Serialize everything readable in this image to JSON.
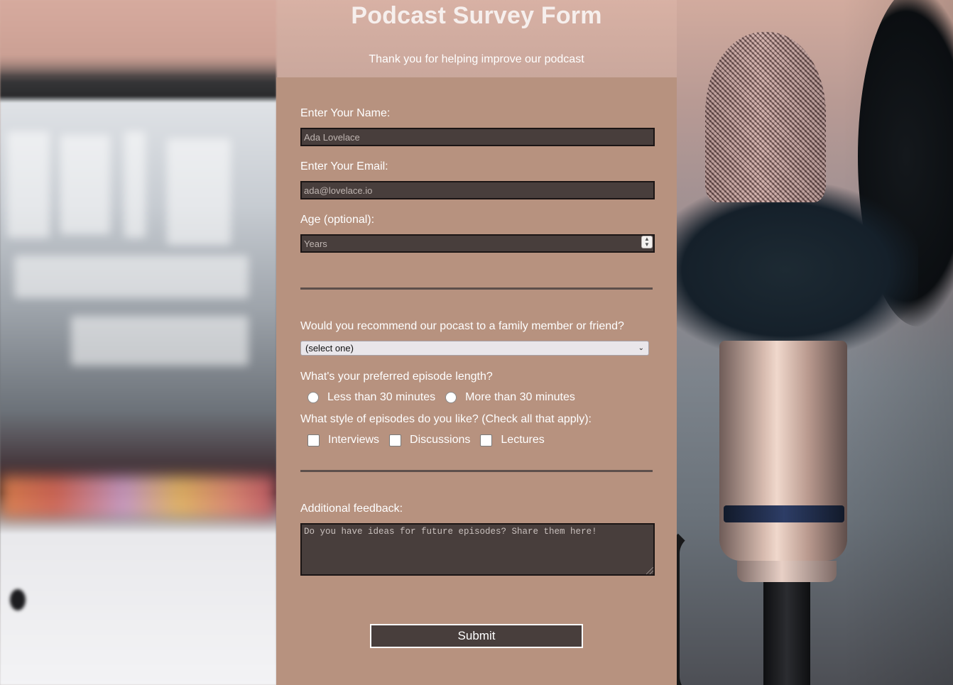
{
  "header": {
    "title": "Podcast Survey Form",
    "subtitle": "Thank you for helping improve our podcast"
  },
  "form": {
    "name": {
      "label": "Enter Your Name:",
      "placeholder": "Ada Lovelace",
      "value": ""
    },
    "email": {
      "label": "Enter Your Email:",
      "placeholder": "ada@lovelace.io",
      "value": ""
    },
    "age": {
      "label": "Age (optional):",
      "placeholder": "Years",
      "value": ""
    },
    "recommend": {
      "label": "Would you recommend our pocast to a family member or friend?",
      "selected": "(select one)"
    },
    "episode_length": {
      "label": "What's your preferred episode length?",
      "options": [
        "Less than 30 minutes",
        "More than 30 minutes"
      ]
    },
    "styles": {
      "label": "What style of episodes do you like? (Check all that apply):",
      "options": [
        "Interviews",
        "Discussions",
        "Lectures"
      ]
    },
    "feedback": {
      "label": "Additional feedback:",
      "placeholder": "Do you have ideas for future episodes? Share them here!"
    },
    "submit_label": "Submit"
  },
  "icons": {
    "select_chevron": "chevron-down-icon",
    "number_spinner": "spinner-icon"
  },
  "colors": {
    "panel_bg": "#b7927f",
    "input_bg": "#483e3c",
    "divider": "#5d4f4b",
    "text": "#ffffff"
  }
}
